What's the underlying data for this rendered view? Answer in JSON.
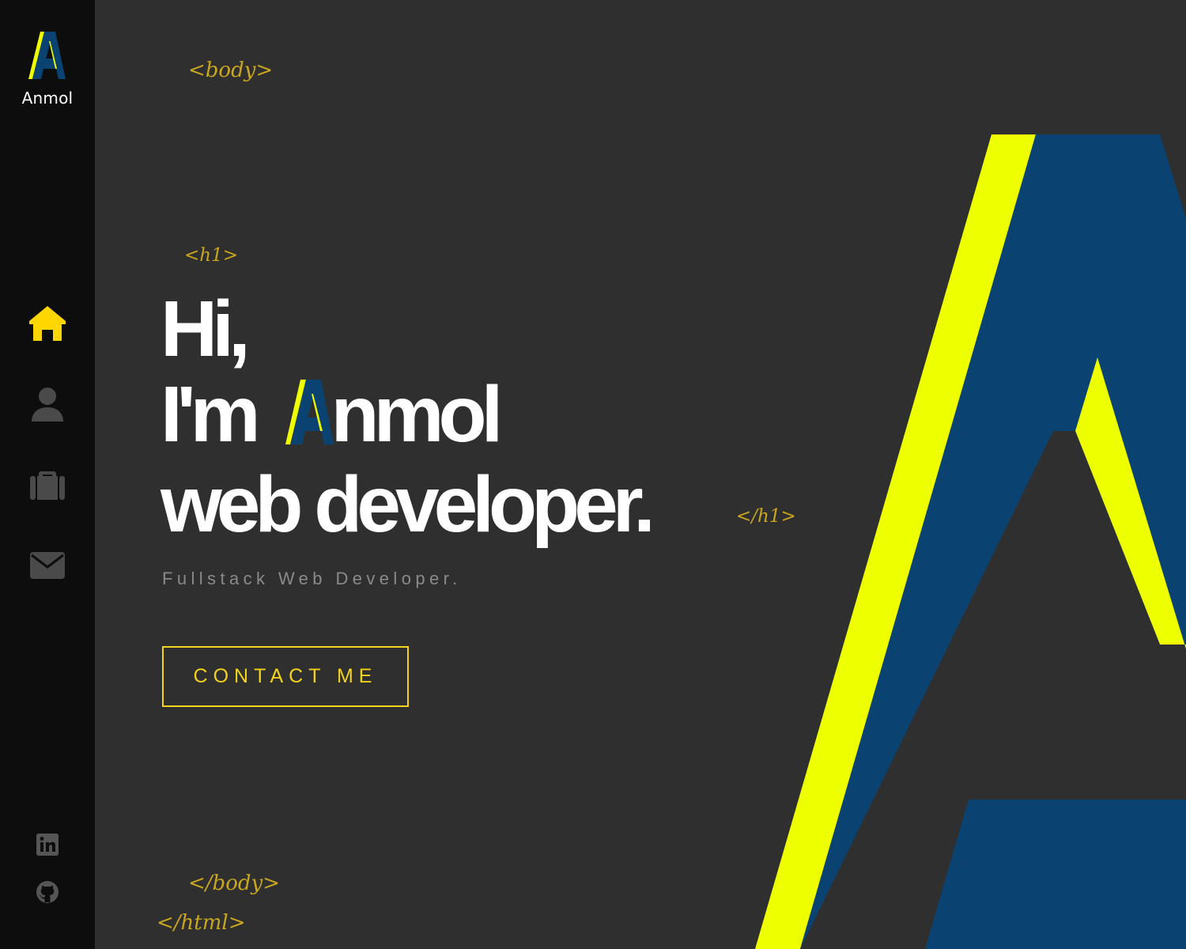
{
  "brand": {
    "name": "Anmol",
    "letter": "A"
  },
  "nav": [
    {
      "label": "home",
      "icon": "home-icon",
      "active": true
    },
    {
      "label": "about",
      "icon": "user-icon",
      "active": false
    },
    {
      "label": "portfolio",
      "icon": "briefcase-icon",
      "active": false
    },
    {
      "label": "contact",
      "icon": "envelope-icon",
      "active": false
    }
  ],
  "social": [
    {
      "label": "linkedin",
      "icon": "linkedin-icon"
    },
    {
      "label": "github",
      "icon": "github-icon"
    }
  ],
  "tags": {
    "body_open": "<body>",
    "h1_open": "<h1>",
    "h1_close": "</h1>",
    "body_close": "</body>",
    "html_close": "</html>"
  },
  "hero": {
    "line1": "Hi,",
    "line2_prefix": "I'm",
    "line2_suffix": "nmol",
    "line3": "web developer.",
    "subtitle": "Fullstack Web Developer.",
    "cta": "CONTACT ME"
  },
  "colors": {
    "accent": "#f2d21b",
    "logo_yellow": "#eeff00",
    "logo_blue": "#0a4372",
    "sidebar_bg": "#0d0d0d",
    "page_bg": "#2f2f2f",
    "tag": "#c9a61f"
  }
}
